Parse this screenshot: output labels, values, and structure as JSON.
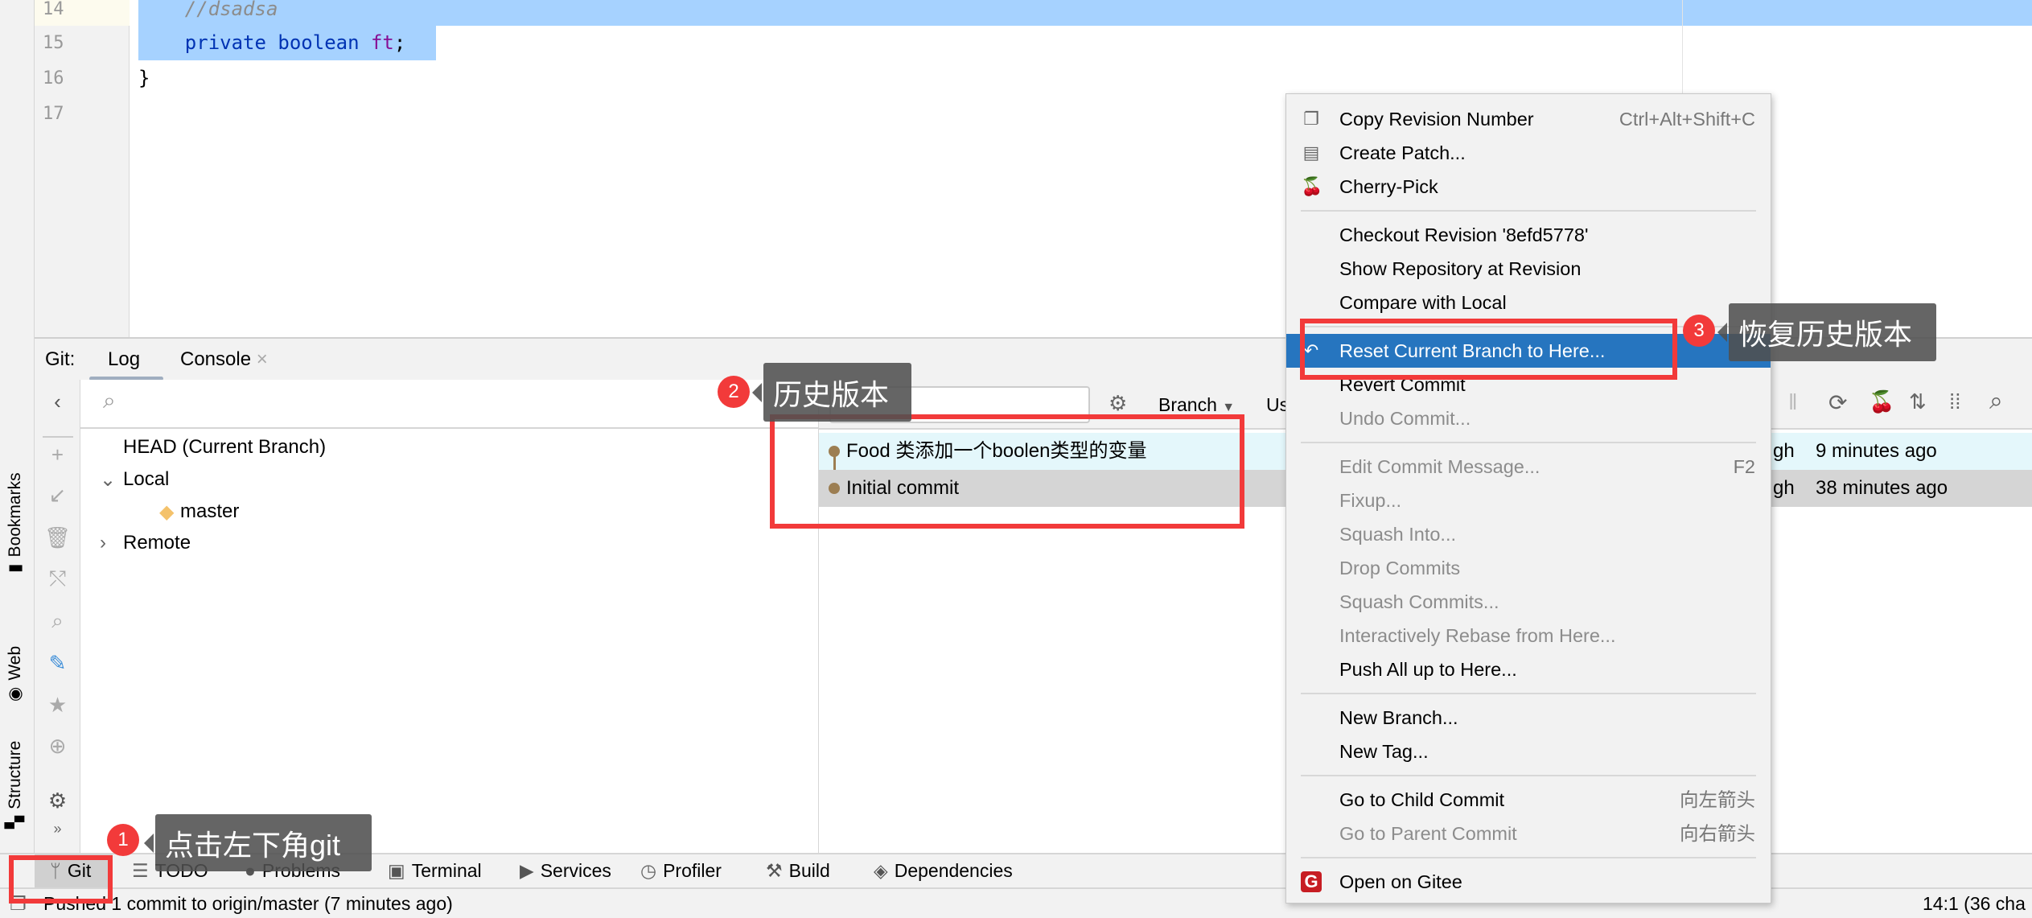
{
  "editor": {
    "lines": [
      {
        "num": "14",
        "code": "    //dsadsa"
      },
      {
        "num": "15",
        "kw": "    private boolean ",
        "ident": "ft",
        "tail": ";"
      },
      {
        "num": "16",
        "code": "}"
      },
      {
        "num": "17",
        "code": ""
      }
    ]
  },
  "side_stripe": {
    "bookmarks": "Bookmarks",
    "web": "Web",
    "structure": "Structure"
  },
  "git_window": {
    "title": "Git:",
    "tabs": [
      {
        "label": "Log",
        "active": true
      },
      {
        "label": "Console"
      }
    ],
    "branches": {
      "head": "HEAD (Current Branch)",
      "local": "Local",
      "master": "master",
      "remote": "Remote"
    },
    "filters": {
      "branch": "Branch",
      "user": "Us"
    },
    "commits": [
      {
        "message": "Food 类添加一个boolen类型的变量",
        "author": "gh",
        "date": "9 minutes ago"
      },
      {
        "message": "Initial commit",
        "author": "gh",
        "date": "38 minutes ago"
      }
    ]
  },
  "context_menu": {
    "items": [
      {
        "label": "Copy Revision Number",
        "shortcut": "Ctrl+Alt+Shift+C",
        "icon": "copy-icon"
      },
      {
        "label": "Create Patch...",
        "icon": "patch-icon"
      },
      {
        "label": "Cherry-Pick",
        "icon": "cherry-icon"
      },
      {
        "sep": true
      },
      {
        "label": "Checkout Revision '8efd5778'"
      },
      {
        "label": "Show Repository at Revision"
      },
      {
        "label": "Compare with Local"
      },
      {
        "sep": true
      },
      {
        "label": "Reset Current Branch to Here...",
        "icon": "undo-icon",
        "highlighted": true
      },
      {
        "label": "Revert Commit"
      },
      {
        "label": "Undo Commit...",
        "disabled": true
      },
      {
        "sep": true
      },
      {
        "label": "Edit Commit Message...",
        "shortcut": "F2",
        "disabled": true
      },
      {
        "label": "Fixup...",
        "disabled": true
      },
      {
        "label": "Squash Into...",
        "disabled": true
      },
      {
        "label": "Drop Commits",
        "disabled": true
      },
      {
        "label": "Squash Commits...",
        "disabled": true
      },
      {
        "label": "Interactively Rebase from Here...",
        "disabled": true
      },
      {
        "label": "Push All up to Here..."
      },
      {
        "sep": true
      },
      {
        "label": "New Branch..."
      },
      {
        "label": "New Tag..."
      },
      {
        "sep": true
      },
      {
        "label": "Go to Child Commit",
        "shortcut": "向左箭头"
      },
      {
        "label": "Go to Parent Commit",
        "shortcut": "向右箭头",
        "disabled": true
      },
      {
        "sep": true
      },
      {
        "label": "Open on Gitee",
        "icon": "gitee-icon"
      }
    ]
  },
  "tool_windows": [
    "Git",
    "TODO",
    "Problems",
    "Terminal",
    "Services",
    "Profiler",
    "Build",
    "Dependencies"
  ],
  "status": {
    "message": "Pushed 1 commit to origin/master (7 minutes ago)",
    "position": "14:1 (36 cha"
  },
  "annotations": {
    "step1": {
      "num": "1",
      "text": "点击左下角git"
    },
    "step2": {
      "num": "2",
      "text": "历史版本"
    },
    "step3": {
      "num": "3",
      "text": "恢复历史版本"
    }
  },
  "colors": {
    "highlight": "#2675bf",
    "selection": "#a6d2ff",
    "annotation_red": "#f23a3a",
    "row_selected": "#e4f7fb"
  }
}
